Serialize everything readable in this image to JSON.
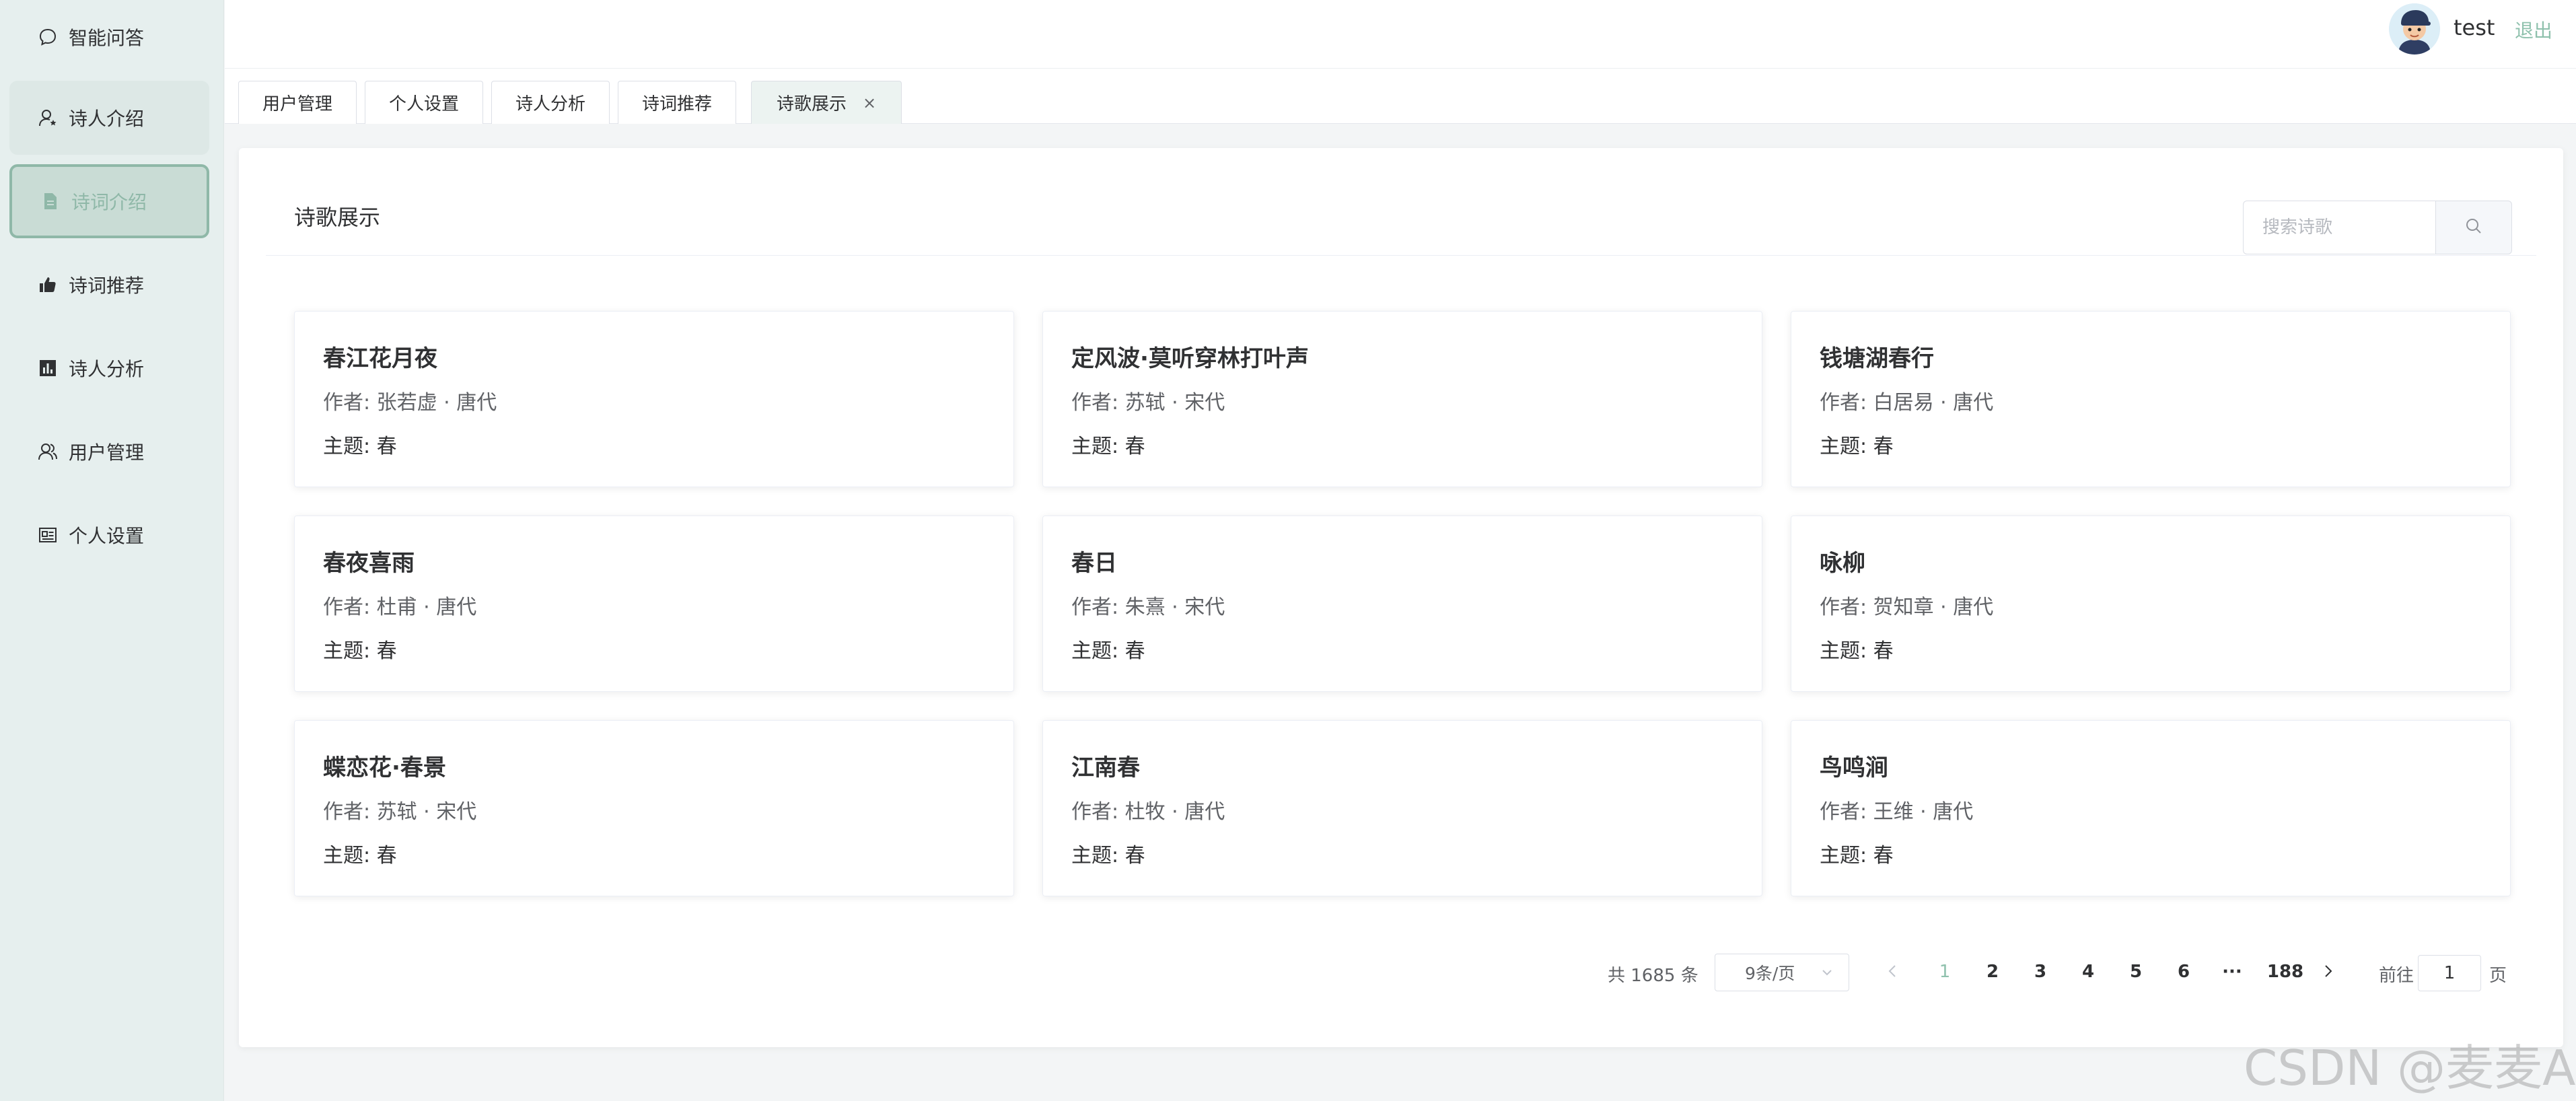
{
  "colors": {
    "accent": "#8fc1ad",
    "sidebar_bg": "#e6efee",
    "active_item_bg": "#c9dcd5"
  },
  "sidebar": {
    "items": [
      {
        "label": "智能问答",
        "icon": "chat-bubble-icon",
        "active": false
      },
      {
        "label": "诗人介绍",
        "icon": "user-star-icon",
        "active": false
      },
      {
        "label": "诗词介绍",
        "icon": "document-icon",
        "active": true
      },
      {
        "label": "诗词推荐",
        "icon": "thumbs-up-icon",
        "active": false
      },
      {
        "label": "诗人分析",
        "icon": "bar-chart-icon",
        "active": false
      },
      {
        "label": "用户管理",
        "icon": "users-icon",
        "active": false
      },
      {
        "label": "个人设置",
        "icon": "id-card-icon",
        "active": false
      }
    ]
  },
  "header": {
    "username": "test",
    "logout_label": "退出"
  },
  "tabs": [
    {
      "label": "用户管理",
      "active": false
    },
    {
      "label": "个人设置",
      "active": false
    },
    {
      "label": "诗人分析",
      "active": false
    },
    {
      "label": "诗词推荐",
      "active": false
    },
    {
      "label": "诗歌展示",
      "active": true,
      "closable": true,
      "close_glyph": "×"
    }
  ],
  "main": {
    "title": "诗歌展示",
    "search": {
      "placeholder": "搜索诗歌",
      "value": ""
    },
    "poems": [
      {
        "title": "春江花月夜",
        "author": "作者: 张若虚 · 唐代",
        "theme": "主题:  春"
      },
      {
        "title": "定风波·莫听穿林打叶声",
        "author": "作者: 苏轼 · 宋代",
        "theme": "主题:  春"
      },
      {
        "title": "钱塘湖春行",
        "author": "作者: 白居易 · 唐代",
        "theme": "主题:  春"
      },
      {
        "title": "春夜喜雨",
        "author": "作者: 杜甫 · 唐代",
        "theme": "主题:  春"
      },
      {
        "title": "春日",
        "author": "作者: 朱熹 · 宋代",
        "theme": "主题:  春"
      },
      {
        "title": "咏柳",
        "author": "作者: 贺知章 · 唐代",
        "theme": "主题:  春"
      },
      {
        "title": "蝶恋花·春景",
        "author": "作者: 苏轼 · 宋代",
        "theme": "主题:  春"
      },
      {
        "title": "江南春",
        "author": "作者: 杜牧 · 唐代",
        "theme": "主题:  春"
      },
      {
        "title": "鸟鸣涧",
        "author": "作者: 王维 · 唐代",
        "theme": "主题:  春"
      }
    ]
  },
  "pagination": {
    "total_text": "共 1685 条",
    "page_size": "9条/页",
    "current_page": "1",
    "pages": [
      "1",
      "2",
      "3",
      "4",
      "5",
      "6",
      "···",
      "188"
    ],
    "goto_label": "前往",
    "goto_value": "1",
    "page_unit": "页"
  },
  "watermark": "CSDN @麦麦AI"
}
